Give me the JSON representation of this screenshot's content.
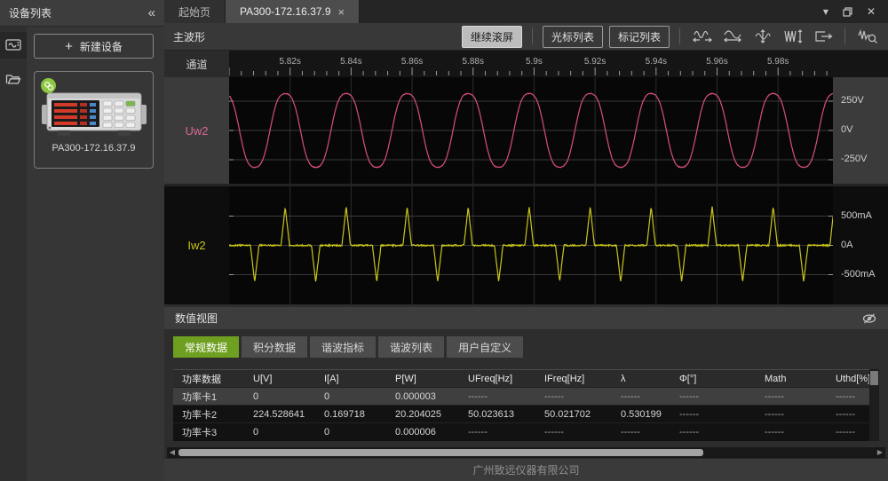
{
  "sidebar": {
    "title": "设备列表",
    "collapse_glyph": "«",
    "plus_glyph": "+",
    "new_device_label": "新建设备",
    "device_name": "PA300-172.16.37.9",
    "device_status_icon": "link-connected"
  },
  "tab_bar": {
    "home_tab": "起始页",
    "device_tab": "PA300-172.16.37.9",
    "close_glyph": "×",
    "window_controls": {
      "dropdown_glyph": "▾",
      "restore_icon": "restore-window",
      "close_glyph": "✕"
    }
  },
  "toolbar": {
    "title": "主波形",
    "continue_scroll_label": "继续滚屏",
    "cursor_list_label": "光标列表",
    "marker_list_label": "标记列表",
    "icons": [
      "hscale-expand-icon",
      "hscale-fit-icon",
      "vscale-fit-icon",
      "compress-wave-icon",
      "export-icon",
      "waveform-zoom-icon"
    ]
  },
  "waveform": {
    "corner_label": "通道"
  },
  "chart_data": [
    {
      "type": "line",
      "name": "Uw2",
      "unit": "V",
      "color": "#d94f7e",
      "x_start_s": 5.8,
      "x_end_s": 5.998,
      "x_ticks_s": [
        5.82,
        5.84,
        5.86,
        5.88,
        5.9,
        5.92,
        5.94,
        5.96,
        5.98
      ],
      "x_tick_labels": [
        "5.82s",
        "5.84s",
        "5.86s",
        "5.88s",
        "5.9s",
        "5.92s",
        "5.94s",
        "5.96s",
        "5.98s"
      ],
      "y_ticks": [
        250,
        0,
        -250
      ],
      "y_tick_labels": [
        "250V",
        "0V",
        "-250V"
      ],
      "ylim": [
        -455,
        455
      ],
      "waveform": {
        "shape": "flat_top_sine",
        "freq_hz": 50,
        "period_s": 0.02,
        "phase_ref_s": 5.7984,
        "fundamental": 340,
        "third_harmonic": -25,
        "peak_v": 315,
        "rms_v": 224.528641
      }
    },
    {
      "type": "line",
      "name": "Iw2",
      "unit": "mA",
      "color": "#c9c61b",
      "x_start_s": 5.8,
      "x_end_s": 5.998,
      "y_ticks": [
        500,
        0,
        -500
      ],
      "y_tick_labels": [
        "500mA",
        "0A",
        "-500mA"
      ],
      "ylim": [
        -1007,
        1007
      ],
      "waveform": {
        "shape": "spike_train",
        "freq_hz": 50,
        "period_s": 0.02,
        "phase_ref_s": 5.7984,
        "pos_spike_ma": 660,
        "neg_spike_ma": -625,
        "spike_width_frac": 0.07,
        "baseline_ma": 0,
        "pos_spike_at_voltage_peak": true,
        "rms_a": 0.169718
      }
    }
  ],
  "numeric_view": {
    "title": "数值视图",
    "visibility_icon": "eye-off",
    "tabs": [
      {
        "label": "常规数据",
        "active": true
      },
      {
        "label": "积分数据",
        "active": false
      },
      {
        "label": "谐波指标",
        "active": false
      },
      {
        "label": "谐波列表",
        "active": false
      },
      {
        "label": "用户自定义",
        "active": false
      }
    ],
    "table": {
      "columns": [
        "功率数据",
        "U[V]",
        "I[A]",
        "P[W]",
        "UFreq[Hz]",
        "IFreq[Hz]",
        "λ",
        "Φ[°]",
        "Math",
        "Uthd[%]"
      ],
      "rows": [
        {
          "name": "功率卡1",
          "selected": true,
          "values": [
            "0",
            "0",
            "0.000003",
            "------",
            "------",
            "------",
            "------",
            "------",
            "------"
          ]
        },
        {
          "name": "功率卡2",
          "selected": false,
          "values": [
            "224.528641",
            "0.169718",
            "20.204025",
            "50.023613",
            "50.021702",
            "0.530199",
            "------",
            "------",
            "------"
          ]
        },
        {
          "name": "功率卡3",
          "selected": false,
          "values": [
            "0",
            "0",
            "0.000006",
            "------",
            "------",
            "------",
            "------",
            "------",
            "------"
          ]
        }
      ]
    }
  },
  "footer": {
    "company": "广州致远仪器有限公司"
  },
  "colors": {
    "accent_green": "#6f9f21",
    "voltage_pink": "#d94f7e",
    "current_yellow": "#c9c61b",
    "badge_green": "#8dc63f"
  }
}
